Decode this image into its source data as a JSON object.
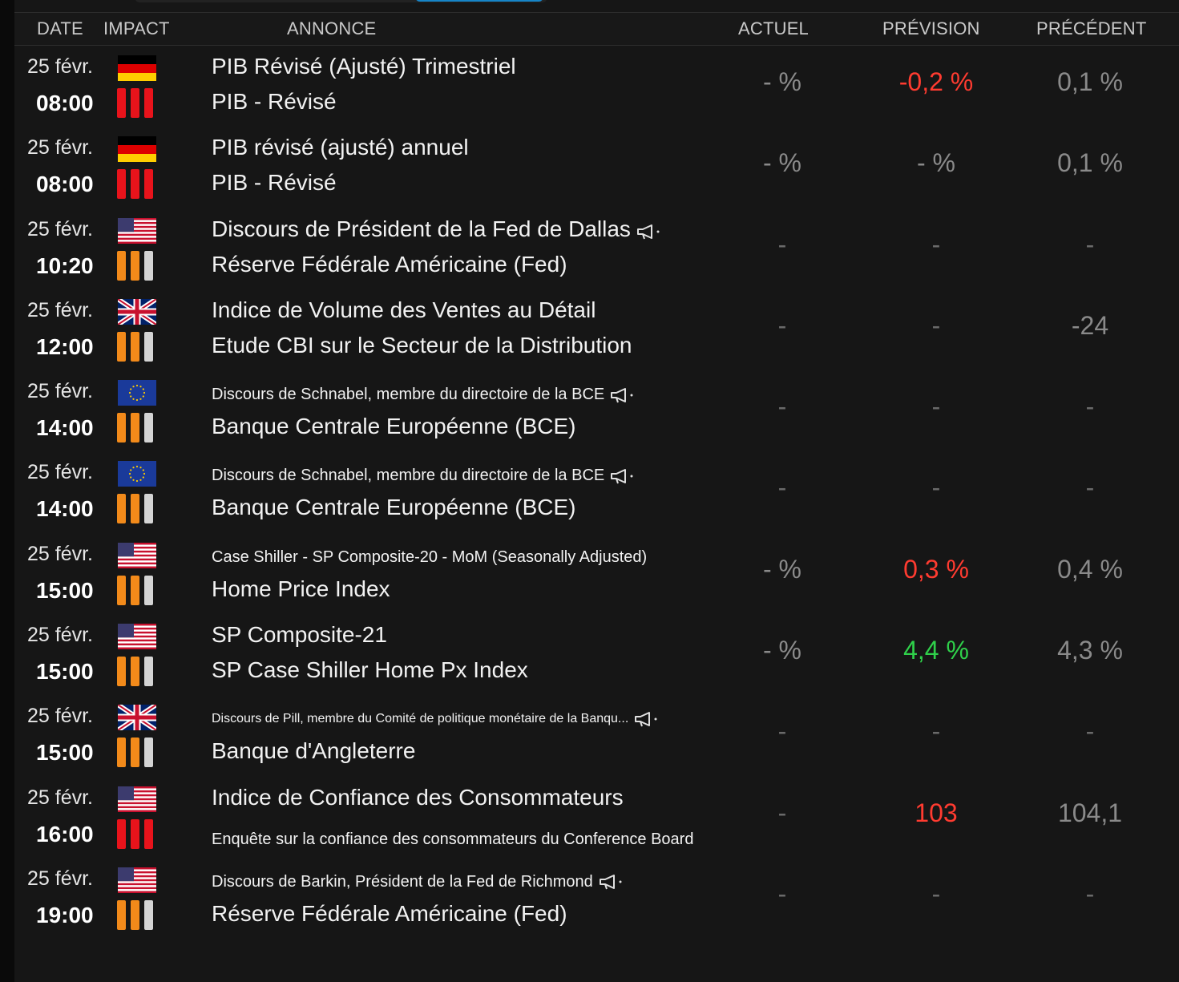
{
  "header": {
    "date": "DATE",
    "impact": "IMPACT",
    "annonce": "ANNONCE",
    "actuel": "ACTUEL",
    "prevision": "PRÉVISION",
    "precedent": "PRÉCÉDENT"
  },
  "rows": [
    {
      "date": "25 févr.",
      "time": "08:00",
      "flag": "germany-flag-icon",
      "impact": "high",
      "line1": "PIB Révisé (Ajusté) Trimestriel",
      "line2": "PIB - Révisé",
      "actuel": "- %",
      "prevision": "-0,2 %",
      "precedent": "0,1 %"
    },
    {
      "date": "25 févr.",
      "time": "08:00",
      "flag": "germany-flag-icon",
      "impact": "high",
      "line1": "PIB révisé (ajusté) annuel",
      "line2": "PIB - Révisé",
      "actuel": "- %",
      "prevision": "- %",
      "precedent": "0,1 %"
    },
    {
      "date": "25 févr.",
      "time": "10:20",
      "flag": "usa-flag-icon",
      "impact": "medium",
      "line1": "Discours de Président de la Fed de Dallas",
      "line2": "Réserve Fédérale Américaine (Fed)",
      "actuel": "-",
      "prevision": "-",
      "precedent": "-"
    },
    {
      "date": "25 févr.",
      "time": "12:00",
      "flag": "uk-flag-icon",
      "impact": "medium",
      "line1": "Indice de Volume des Ventes au Détail",
      "line2": "Etude CBI sur le Secteur de la Distribution",
      "actuel": "-",
      "prevision": "-",
      "precedent": "-24"
    },
    {
      "date": "25 févr.",
      "time": "14:00",
      "flag": "eu-flag-icon",
      "impact": "medium",
      "line1": "Discours de Schnabel, membre du directoire de la BCE",
      "line2": "Banque Centrale Européenne (BCE)",
      "actuel": "-",
      "prevision": "-",
      "precedent": "-"
    },
    {
      "date": "25 févr.",
      "time": "14:00",
      "flag": "eu-flag-icon",
      "impact": "medium",
      "line1": "Discours de Schnabel, membre du directoire de la BCE",
      "line2": "Banque Centrale Européenne (BCE)",
      "actuel": "-",
      "prevision": "-",
      "precedent": "-"
    },
    {
      "date": "25 févr.",
      "time": "15:00",
      "flag": "usa-flag-icon",
      "impact": "medium",
      "line1": "Case Shiller - SP Composite-20 - MoM (Seasonally Adjusted)",
      "line2": "Home Price Index",
      "actuel": "- %",
      "prevision": "0,3 %",
      "precedent": "0,4 %"
    },
    {
      "date": "25 févr.",
      "time": "15:00",
      "flag": "usa-flag-icon",
      "impact": "medium",
      "line1": "SP Composite-21",
      "line2": "SP Case Shiller Home Px Index",
      "actuel": "- %",
      "prevision": "4,4 %",
      "precedent": "4,3 %"
    },
    {
      "date": "25 févr.",
      "time": "15:00",
      "flag": "uk-flag-icon",
      "impact": "medium",
      "line1": "Discours de Pill, membre du Comité de politique monétaire de la Banqu...",
      "line2": "Banque d'Angleterre",
      "actuel": "-",
      "prevision": "-",
      "precedent": "-"
    },
    {
      "date": "25 févr.",
      "time": "16:00",
      "flag": "usa-flag-icon",
      "impact": "high",
      "line1": "Indice de Confiance des Consommateurs",
      "line2": "Enquête sur la confiance des consommateurs du Conference Board",
      "actuel": "-",
      "prevision": "103",
      "precedent": "104,1"
    },
    {
      "date": "25 févr.",
      "time": "19:00",
      "flag": "usa-flag-icon",
      "impact": "medium",
      "line1": "Discours de Barkin, Président de la Fed de Richmond",
      "line2": "Réserve Fédérale Américaine (Fed)",
      "actuel": "-",
      "prevision": "-",
      "precedent": "-"
    }
  ],
  "colors": {
    "negative": "#ff3b30",
    "positive": "#2fd04a",
    "impact_high": "#e8131b",
    "impact_medium": "#f28a1a",
    "impact_empty": "#d4d4d4"
  }
}
